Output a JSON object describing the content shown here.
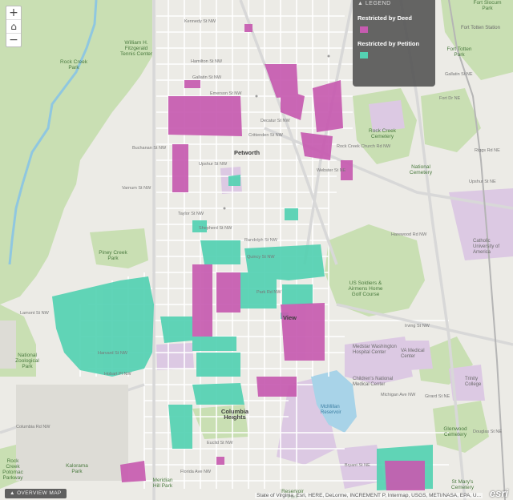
{
  "legend": {
    "header": "LEGEND",
    "items": [
      {
        "label": "Restricted by Deed",
        "color": "#c75bb0"
      },
      {
        "label": "Restricted by Petition",
        "color": "#54d1b2"
      }
    ]
  },
  "zoom": {
    "in": "+",
    "home": "⌂",
    "out": "−"
  },
  "overview": "OVERVIEW MAP",
  "attribution": "State of Virginia, Esri, HERE, DeLorme, INCREMENT P, Intermap, USGS, METI/NASA, EPA, U...",
  "logo": "esri",
  "colors": {
    "park": "#c9dfb3",
    "water": "#a8d3e8",
    "institution": "#dcc9e3",
    "road": "#ffffff",
    "major_road": "#f2f2f2",
    "base": "#ecebe6"
  },
  "labels": {
    "parks": [
      "William H. Fitzgerald Tennis Center",
      "Rock Creek Park",
      "Piney Creek Park",
      "National Zoological Park",
      "Rock Creek Cemetery",
      "National Cemetery",
      "Fort Totten Park",
      "Fort Slocum Park",
      "Glenwood Cemetery",
      "St Mary's Cemetery"
    ],
    "neighborhoods": [
      "Petworth",
      "Columbia Heights",
      "View"
    ],
    "places": [
      "US Soldiers & Airmens Home Golf Course",
      "Washington Hospital Center",
      "Medstar Washington Hospital Center",
      "Children's National Medical Center",
      "VA Medical Center",
      "Catholic University of America",
      "Trinity College",
      "McMillan Reservoir",
      "Fort Totten Station",
      "Reservoir Park",
      "Kalorama Park",
      "Meridian Hill Park",
      "Rock Creek Potomac Parkway"
    ],
    "streets": [
      "Kennedy St NW",
      "Hamilton St NW",
      "Gallatin St NW",
      "Emerson St NW",
      "Decatur St NW",
      "Crittenden St NW",
      "Buchanan St NW",
      "Upshur St NW",
      "Webster St NE",
      "Varnum St NW",
      "Taylor St NW",
      "Shepherd St NW",
      "Randolph St NW",
      "Quincy St NW",
      "Park Rd NW",
      "Irving St NW",
      "Harvard St NW",
      "Hobart Pl NW",
      "Michigan Ave NW",
      "Columbia Rd NW",
      "Euclid St NW",
      "Girard St NE",
      "Harewood Rd NW",
      "Rock Creek Church Rd NW",
      "Riggs Rd NE",
      "Lamont St NW",
      "Upshur St NE",
      "Douglas St NE",
      "Bryant St NE",
      "Florida Ave NW",
      "Fort Dr NE",
      "Gallatin St NE"
    ]
  }
}
